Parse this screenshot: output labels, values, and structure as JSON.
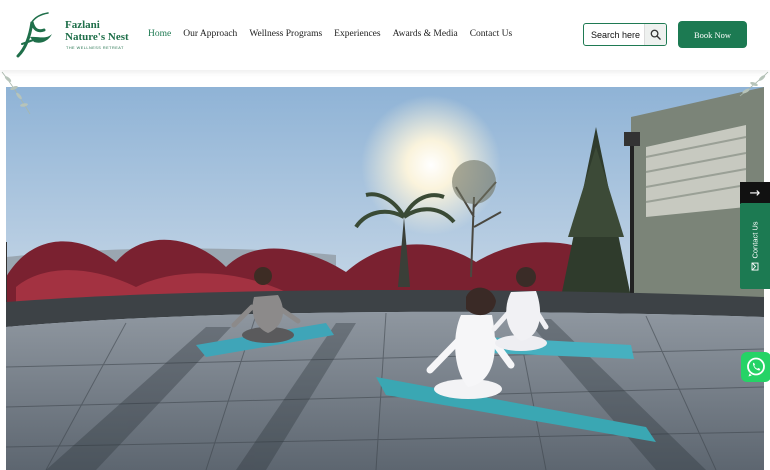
{
  "brand": {
    "name_line1": "Fazlani",
    "name_line2": "Nature's Nest",
    "tagline": "THE WELLNESS RETREAT",
    "color": "#1f6f4a"
  },
  "nav": {
    "items": [
      {
        "label": "Home",
        "active": true
      },
      {
        "label": "Our Approach",
        "active": false
      },
      {
        "label": "Wellness Programs",
        "active": false
      },
      {
        "label": "Experiences",
        "active": false
      },
      {
        "label": "Awards & Media",
        "active": false
      },
      {
        "label": "Contact Us",
        "active": false
      }
    ]
  },
  "search": {
    "placeholder": "Search here",
    "icon": "search-icon"
  },
  "book_button": {
    "label": "Book Now",
    "color": "#1c7a52"
  },
  "hero": {
    "alt": "Yoga session on a rooftop terrace at sunrise"
  },
  "side": {
    "next_icon": "arrow-right-icon",
    "contact_label": "Contact Us",
    "contact_icon": "envelope-icon",
    "whatsapp_icon": "whatsapp-icon"
  }
}
